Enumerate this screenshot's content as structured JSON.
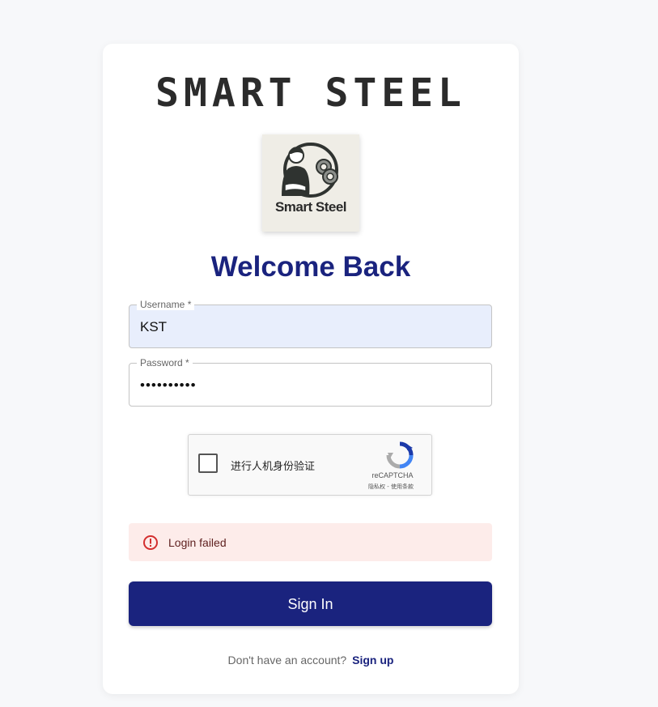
{
  "brand": {
    "name": "SMART STEEL",
    "logo_text": "Smart Steel"
  },
  "title": "Welcome Back",
  "form": {
    "username_label": "Username *",
    "username_value": "KST",
    "password_label": "Password *",
    "password_masked": "••••••••••"
  },
  "captcha": {
    "label": "进行人机身份验证",
    "brand": "reCAPTCHA",
    "terms": "隐私权 - 使用条款"
  },
  "alert": {
    "severity": "error",
    "message": "Login failed",
    "icon": "error-outline-icon"
  },
  "signin_label": "Sign In",
  "signup": {
    "prompt": "Don't have an account?",
    "link": "Sign up"
  },
  "colors": {
    "primary": "#1a237e",
    "alert_bg": "#fdecea",
    "alert_icon": "#d32f2f",
    "autofill_bg": "#e8eefc"
  }
}
